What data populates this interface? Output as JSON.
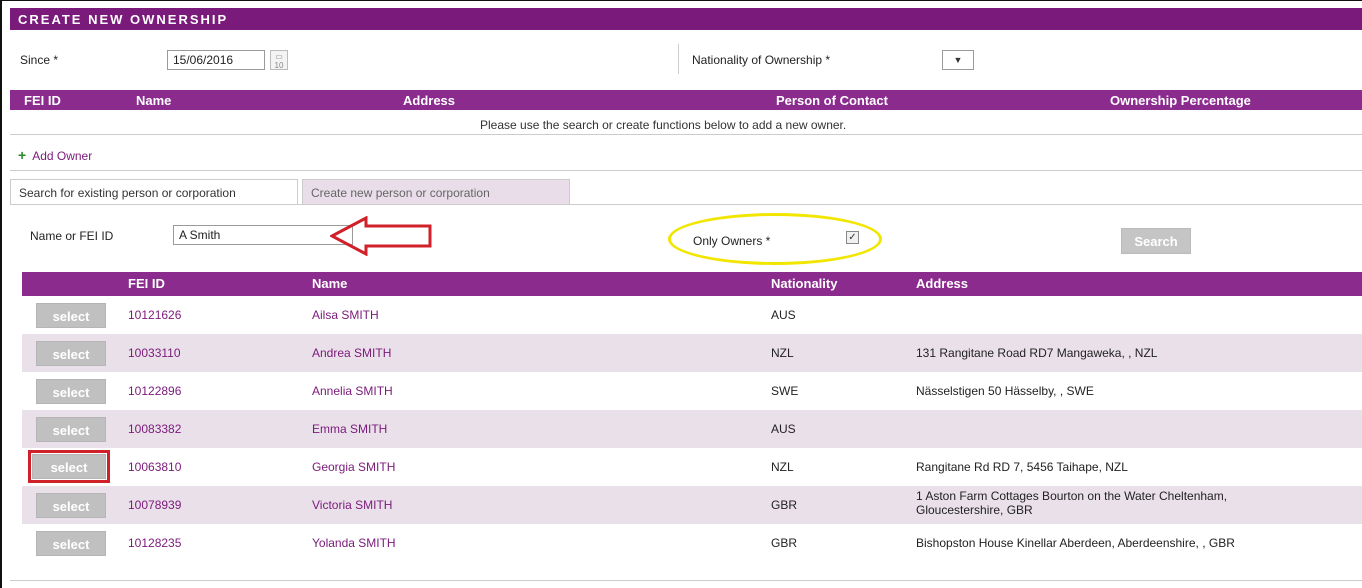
{
  "title": "CREATE NEW OWNERSHIP",
  "since": {
    "label": "Since *",
    "value": "15/06/2016",
    "calendar_icon_text": "10"
  },
  "nationality": {
    "label": "Nationality of Ownership *",
    "value": ""
  },
  "owners_table": {
    "headers": [
      "FEI ID",
      "Name",
      "Address",
      "Person of Contact",
      "Ownership Percentage"
    ],
    "empty_message": "Please use the search or create functions below to add a new owner."
  },
  "add_owner_label": "Add Owner",
  "tabs": [
    "Search for existing person or corporation",
    "Create new person or corporation"
  ],
  "search": {
    "name_label": "Name or FEI ID",
    "name_value": "A Smith",
    "only_owners_label": "Only Owners *",
    "only_owners_checked": true,
    "search_button": "Search"
  },
  "results": {
    "headers": [
      "FEI ID",
      "Name",
      "Nationality",
      "Address"
    ],
    "select_label": "select",
    "rows": [
      {
        "fei_id": "10121626",
        "name": "Ailsa SMITH",
        "nationality": "AUS",
        "address": ""
      },
      {
        "fei_id": "10033110",
        "name": "Andrea SMITH",
        "nationality": "NZL",
        "address": "131 Rangitane Road RD7 Mangaweka, , NZL"
      },
      {
        "fei_id": "10122896",
        "name": "Annelia SMITH",
        "nationality": "SWE",
        "address": "Nässelstigen 50 Hässelby, , SWE"
      },
      {
        "fei_id": "10083382",
        "name": "Emma SMITH",
        "nationality": "AUS",
        "address": ""
      },
      {
        "fei_id": "10063810",
        "name": "Georgia SMITH",
        "nationality": "NZL",
        "address": "Rangitane Rd RD 7, 5456 Taihape, NZL"
      },
      {
        "fei_id": "10078939",
        "name": "Victoria SMITH",
        "nationality": "GBR",
        "address_line1": "1 Aston Farm Cottages Bourton on the Water Cheltenham,",
        "address_line2": "Gloucestershire, GBR"
      },
      {
        "fei_id": "10128235",
        "name": "Yolanda SMITH",
        "nationality": "GBR",
        "address": "Bishopston House Kinellar Aberdeen, Aberdeenshire, , GBR"
      }
    ]
  },
  "colors": {
    "header_purple": "#8b2b8e",
    "title_purple": "#7a1a7a",
    "row_alt": "#eae0ea",
    "highlight_red": "#d0202a",
    "highlight_yellow": "#f2e600"
  }
}
